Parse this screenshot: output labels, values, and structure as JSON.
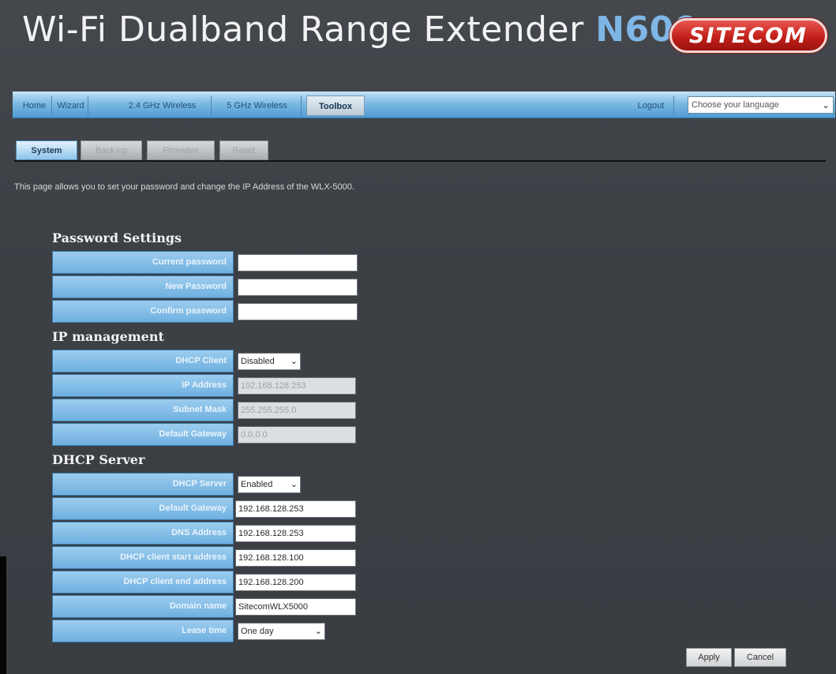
{
  "header": {
    "title": "Wi-Fi Dualband Range Extender",
    "model": "N600",
    "brand": "SITECOM"
  },
  "nav": {
    "items": [
      "Home",
      "Wizard",
      "2.4 GHz Wireless",
      "5 GHz Wireless",
      "Toolbox"
    ],
    "active": "Toolbox",
    "logout": "Logout",
    "language_placeholder": "Choose your language"
  },
  "subtabs": {
    "items": [
      "System",
      "Back-up",
      "Firmware",
      "Reset"
    ],
    "active": "System"
  },
  "description": "This page allows you to set your password and change the IP Address of the WLX-5000.",
  "password_settings": {
    "title": "Password Settings",
    "current_label": "Current password",
    "new_label": "New Password",
    "confirm_label": "Confirm password",
    "current_value": "",
    "new_value": "",
    "confirm_value": ""
  },
  "ip_management": {
    "title": "IP management",
    "dhcp_client_label": "DHCP Client",
    "dhcp_client_value": "Disabled",
    "ip_label": "IP Address",
    "ip_value": "192.168.128.253",
    "mask_label": "Subnet Mask",
    "mask_value": "255.255.255.0",
    "gateway_label": "Default Gateway",
    "gateway_value": "0.0.0.0"
  },
  "dhcp_server": {
    "title": "DHCP Server",
    "server_label": "DHCP Server",
    "server_value": "Enabled",
    "gateway_label": "Default Gateway",
    "gateway_value": "192.168.128.253",
    "dns_label": "DNS Address",
    "dns_value": "192.168.128.253",
    "start_label": "DHCP client start address",
    "start_value": "192.168.128.100",
    "end_label": "DHCP client end address",
    "end_value": "192.168.128.200",
    "domain_label": "Domain name",
    "domain_value": "SitecomWLX5000",
    "lease_label": "Lease time",
    "lease_value": "One day"
  },
  "buttons": {
    "apply": "Apply",
    "cancel": "Cancel"
  },
  "colors": {
    "background": "#3b3f44",
    "nav_blue": "#7ab9e4",
    "label_blue": "#6fb0e0",
    "brand_red": "#c2211a"
  }
}
